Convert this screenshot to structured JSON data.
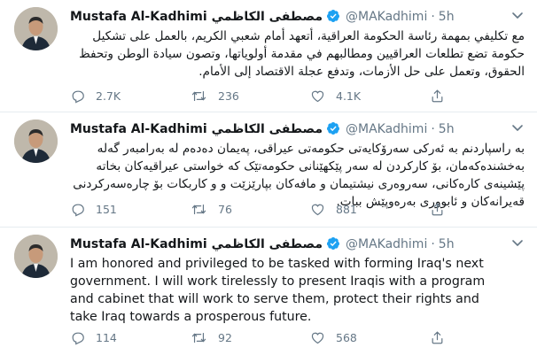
{
  "tweets": [
    {
      "name": "Mustafa Al-Kadhimi مصطفى الكاظمي",
      "handle": "@MAKadhimi",
      "separator": "·",
      "time": "5h",
      "text": "مع تكليفي بمهمة رئاسة الحكومة العراقية، أتعهد أمام شعبي الكريم، بالعمل على تشكيل حكومة تضع تطلعات العراقيين ومطالبهم في مقدمة أولوياتها، وتصون سيادة الوطن وتحفظ الحقوق، وتعمل على حل الأزمات، وتدفع عجلة الاقتصاد إلى الأمام.",
      "replies": "2.7K",
      "retweets": "236",
      "likes": "4.1K"
    },
    {
      "name": "Mustafa Al-Kadhimi مصطفى الكاظمي",
      "handle": "@MAKadhimi",
      "separator": "·",
      "time": "5h",
      "text": "بە راسپاردنم بە ئەرکی سەرۆکایەتی حکومەتی عیراقی، پەیمان دەدەم لە بەرامبەر گەلە بەخشندەکەمان، بۆ کارکردن لە سەر پێکهێنانی حکومەتێک کە خواستی عیراقیەکان بخاتە پێشینەی کارەکانی، سەروەری نیشتیمان و مافەکان بپارێزێت و و کاربکات بۆ چارەسەرکردنی قەیرانەکان و ئابووری بەرەوپێش ببات.",
      "replies": "151",
      "retweets": "76",
      "likes": "881"
    },
    {
      "name": "Mustafa Al-Kadhimi مصطفى الكاظمي",
      "handle": "@MAKadhimi",
      "separator": "·",
      "time": "5h",
      "text": "I am honored and privileged to be tasked with forming Iraq's next government. I will work tirelessly to present Iraqis with a program and cabinet that will work to serve them, protect their rights and take Iraq towards a prosperous future.",
      "replies": "114",
      "retweets": "92",
      "likes": "568"
    }
  ],
  "colors": {
    "verified": "#1da1f2",
    "muted": "#657786",
    "divider": "#e6ecf0"
  },
  "icons": [
    "verified-badge-icon",
    "chevron-down-icon",
    "reply-icon",
    "retweet-icon",
    "like-icon",
    "share-icon"
  ]
}
